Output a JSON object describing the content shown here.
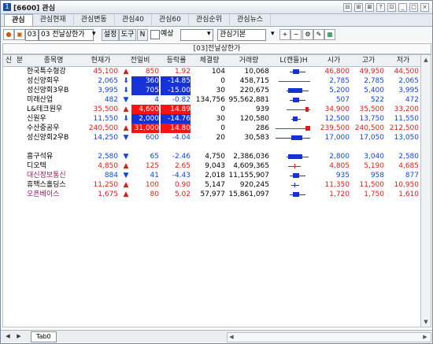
{
  "window": {
    "title": "[6600] 관심",
    "icon_label": "1",
    "buttons": [
      "⊟",
      "⊞",
      "⊠",
      "?",
      "⊡",
      "_",
      "□",
      "×"
    ]
  },
  "tabs": [
    {
      "label": "관심",
      "active": true
    },
    {
      "label": "관심현재"
    },
    {
      "label": "관심변동"
    },
    {
      "label": "관심40"
    },
    {
      "label": "관심60"
    },
    {
      "label": "관심순위"
    },
    {
      "label": "관심뉴스"
    }
  ],
  "toolbar": {
    "group_code": "03",
    "group_select": "03 전날상한가",
    "setup_label": "설정",
    "tools_label": "도구",
    "n_label": "N",
    "forecast_label": "예상",
    "sort_select": "관심기본",
    "add_label": "+",
    "remove_label": "−"
  },
  "group_header": "[03]전날상한가",
  "columns": [
    "신",
    "분",
    "종목명",
    "현재가",
    "전일비",
    "등락률",
    "체결량",
    "거래량",
    "L(캔들)H",
    "시가",
    "고가",
    "저가"
  ],
  "rows": [
    {
      "name": "한국특수형강",
      "price": "45,100",
      "dir": "up",
      "change": "850",
      "rate": "1.92",
      "vol": "104",
      "tvol": "10,068",
      "open": "46,800",
      "high": "49,950",
      "low": "44,500",
      "color": "red",
      "cells": "plain",
      "chart": "blue-minus"
    },
    {
      "name": "성신양회우",
      "price": "2,065",
      "dir": "down",
      "change": "360",
      "rate": "-14.85",
      "vol": "0",
      "tvol": "458,715",
      "open": "2,785",
      "high": "2,785",
      "low": "2,065",
      "color": "blue",
      "cells": "blue",
      "chart": "red-line"
    },
    {
      "name": "성신양회3우B",
      "price": "3,995",
      "dir": "down",
      "change": "705",
      "rate": "-15.00",
      "vol": "30",
      "tvol": "220,675",
      "open": "5,200",
      "high": "5,400",
      "low": "3,995",
      "color": "blue",
      "cells": "blue",
      "chart": "blue-bar"
    },
    {
      "name": "미래산업",
      "price": "482",
      "dir": "down",
      "change": "4",
      "rate": "-0.82",
      "vol": "134,756",
      "tvol": "95,562,881",
      "open": "507",
      "high": "522",
      "low": "472",
      "color": "blue",
      "cells": "plain",
      "chart": "blue-minus"
    },
    {
      "name": "L&테크원우",
      "price": "35,500",
      "dir": "up",
      "change": "4,600",
      "rate": "14.89",
      "vol": "0",
      "tvol": "939",
      "open": "34,900",
      "high": "35,500",
      "low": "33,200",
      "color": "red",
      "cells": "red",
      "chart": "red-end"
    },
    {
      "name": "신원우",
      "price": "11,550",
      "dir": "down",
      "change": "2,000",
      "rate": "-14.76",
      "vol": "30",
      "tvol": "120,580",
      "open": "12,500",
      "high": "13,750",
      "low": "11,550",
      "color": "blue",
      "cells": "blue",
      "chart": "blue-small"
    },
    {
      "name": "수산중공우",
      "price": "240,500",
      "dir": "up",
      "change": "31,000",
      "rate": "14.80",
      "vol": "0",
      "tvol": "286",
      "open": "239,500",
      "high": "240,500",
      "low": "212,500",
      "color": "red",
      "cells": "red",
      "chart": "red-bar"
    },
    {
      "name": "성신양회2우B",
      "price": "14,250",
      "dir": "down",
      "change": "600",
      "rate": "-4.04",
      "vol": "20",
      "tvol": "30,583",
      "open": "17,000",
      "high": "17,050",
      "low": "13,050",
      "color": "blue",
      "cells": "plain",
      "chart": "blue-long"
    },
    {
      "name": "",
      "blank": true
    },
    {
      "name": "흥구석유",
      "price": "2,580",
      "dir": "down",
      "change": "65",
      "rate": "-2.46",
      "vol": "4,750",
      "tvol": "2,386,036",
      "open": "2,800",
      "high": "3,040",
      "low": "2,580",
      "color": "blue",
      "cells": "plain",
      "chart": "blue-bar"
    },
    {
      "name": "디오텍",
      "price": "4,850",
      "dir": "up",
      "change": "125",
      "rate": "2.65",
      "vol": "9,043",
      "tvol": "4,609,365",
      "open": "4,805",
      "high": "5,190",
      "low": "4,685",
      "color": "red",
      "cells": "plain",
      "chart": "red-cross"
    },
    {
      "name": "대신정보통신",
      "price": "884",
      "dir": "down",
      "change": "41",
      "rate": "-4.43",
      "vol": "2,018",
      "tvol": "11,155,907",
      "open": "935",
      "high": "958",
      "low": "877",
      "color": "blue",
      "cells": "plain",
      "chart": "blue-minus"
    },
    {
      "name": "휴맥스홀딩스",
      "price": "11,250",
      "dir": "up",
      "change": "100",
      "rate": "0.90",
      "vol": "5,147",
      "tvol": "920,245",
      "open": "11,350",
      "high": "11,500",
      "low": "10,950",
      "color": "red",
      "cells": "plain",
      "chart": "blue-plus"
    },
    {
      "name": "오픈베이스",
      "price": "1,675",
      "dir": "up",
      "change": "80",
      "rate": "5.02",
      "vol": "57,977",
      "tvol": "15,861,097",
      "open": "1,720",
      "high": "1,750",
      "low": "1,610",
      "color": "red",
      "cells": "plain",
      "chart": "blue-minus"
    }
  ],
  "bottom_tab": "Tab0"
}
